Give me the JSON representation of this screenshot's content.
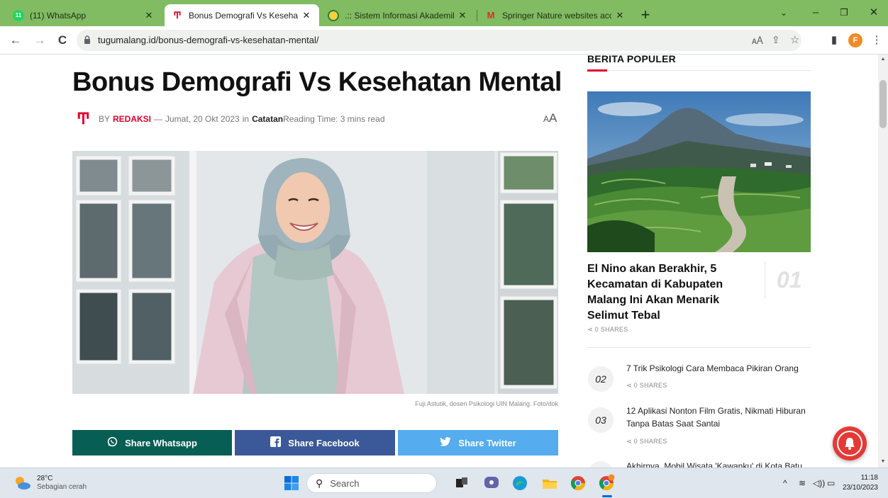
{
  "browser": {
    "tabs": [
      {
        "label": "(11) WhatsApp",
        "badge": "11",
        "active": false
      },
      {
        "label": "Bonus Demografi Vs Kesehatan M",
        "active": true
      },
      {
        "label": ".:: Sistem Informasi Akademik Un",
        "active": false
      },
      {
        "label": "Springer Nature websites access",
        "active": false
      }
    ],
    "new_tab": "+",
    "url": "tugumalang.id/bonus-demografi-vs-kesehatan-mental/",
    "profile_initial": "F"
  },
  "article": {
    "title": "Bonus Demografi Vs Kesehatan Mental",
    "by": "BY",
    "author": "REDAKSI",
    "dash": "—",
    "date": "Jumat, 20 Okt 2023",
    "in": "in",
    "category": "Catatan",
    "reading_time": "Reading Time: 3 mins read",
    "font_toggle_small": "A",
    "font_toggle_large": "A",
    "caption": "Fuji Astutik, dosen Psikologi UIN Malang. Foto/dok",
    "share_buttons": [
      {
        "label": "Share Whatsapp",
        "color": "#075e54"
      },
      {
        "label": "Share Facebook",
        "color": "#3b5998"
      },
      {
        "label": "Share Twitter",
        "color": "#55acee"
      }
    ]
  },
  "sidebar": {
    "title": "BERITA POPULER",
    "featured": {
      "title": "El Nino akan Berakhir, 5 Kecamatan di Kabupaten Malang Ini Akan Menarik Selimut Tebal",
      "rank": "01",
      "shares": "0 SHARES"
    },
    "items": [
      {
        "rank": "02",
        "title": "7 Trik Psikologi Cara Membaca Pikiran Orang",
        "shares": "0 SHARES"
      },
      {
        "rank": "03",
        "title": "12 Aplikasi Nonton Film Gratis, Nikmati Hiburan Tanpa Batas Saat Santai",
        "shares": "0 SHARES"
      },
      {
        "rank": "",
        "title": "Akhirnya, Mobil Wisata 'Kawanku' di Kota Batu",
        "shares": ""
      }
    ]
  },
  "taskbar": {
    "temperature": "28°C",
    "weather": "Sebagian cerah",
    "search_placeholder": "Search",
    "time": "11:18",
    "date": "23/10/2023"
  },
  "colors": {
    "brand_red": "#e4002b",
    "tab_bar_green": "#81bb62"
  }
}
